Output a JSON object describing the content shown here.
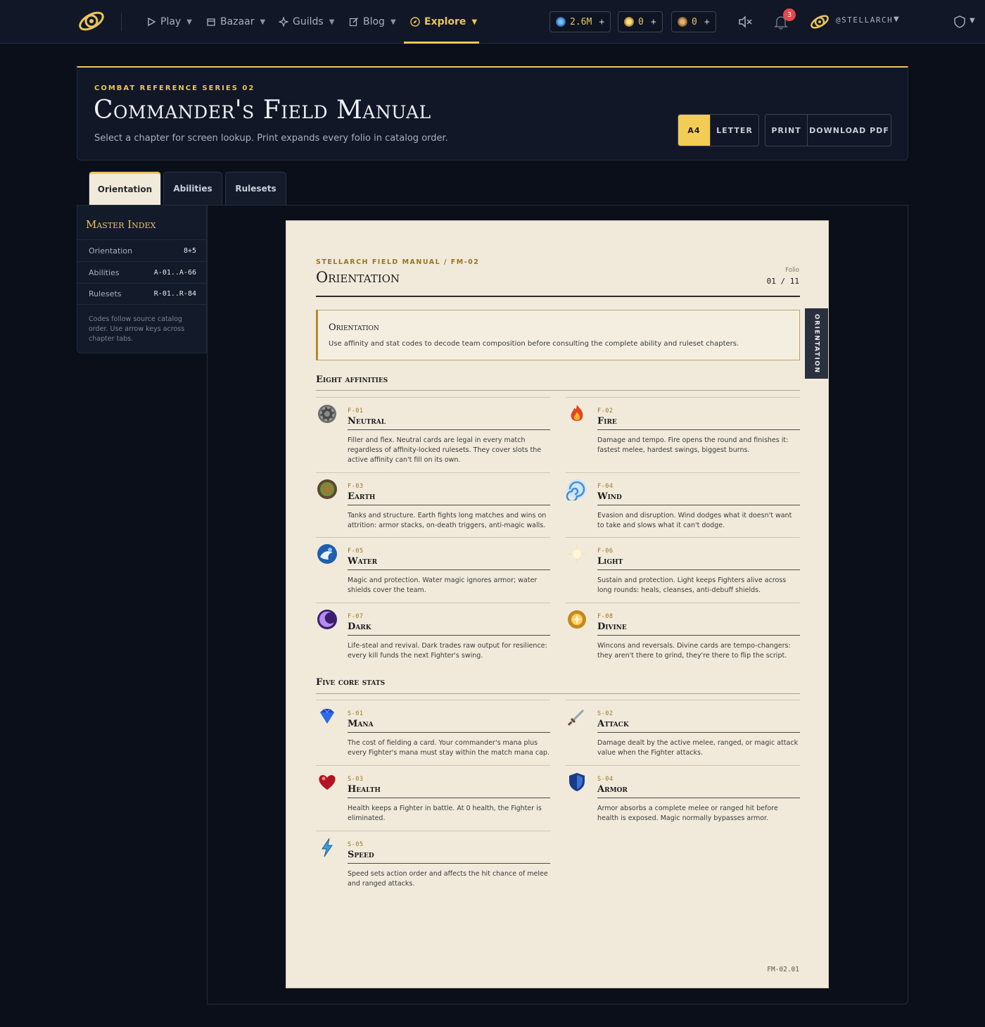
{
  "nav": {
    "items": [
      {
        "label": "Play"
      },
      {
        "label": "Bazaar"
      },
      {
        "label": "Guilds"
      },
      {
        "label": "Blog"
      },
      {
        "label": "Explore"
      }
    ],
    "balances": [
      {
        "value": "2.6M",
        "plus": "+"
      },
      {
        "value": "0",
        "plus": "+"
      },
      {
        "value": "0",
        "plus": "+"
      }
    ],
    "notifications": "3",
    "username": "@STELLARCH"
  },
  "header": {
    "eyebrow": "COMBAT REFERENCE SERIES 02",
    "title": "Commander's Field Manual",
    "subtitle": "Select a chapter for screen lookup. Print expands every folio in catalog order.",
    "paper_sizes": [
      "A4",
      "LETTER"
    ],
    "actions": [
      "PRINT",
      "DOWNLOAD PDF"
    ]
  },
  "tabs": [
    "Orientation",
    "Abilities",
    "Rulesets"
  ],
  "sidebar": {
    "title": "Master Index",
    "rows": [
      {
        "label": "Orientation",
        "code": "8+5"
      },
      {
        "label": "Abilities",
        "code": "A-01..A-66"
      },
      {
        "label": "Rulesets",
        "code": "R-01..R-84"
      }
    ],
    "note": "Codes follow source catalog order. Use arrow keys across chapter tabs."
  },
  "paper": {
    "eyebrow": "STELLARCH FIELD MANUAL / FM-02",
    "title": "Orientation",
    "folio_label": "Folio",
    "folio": "01 / 11",
    "side_tab": "ORIENTATION",
    "callout": {
      "title": "Orientation",
      "body": "Use affinity and stat codes to decode team composition before consulting the complete ability and ruleset chapters."
    },
    "affinities_title": "Eight affinities",
    "affinities": [
      {
        "code": "F-01",
        "name": "Neutral",
        "icon": "neutral-gear-icon",
        "desc": "Filler and flex. Neutral cards are legal in every match regardless of affinity-locked rulesets. They cover slots the active affinity can't fill on its own."
      },
      {
        "code": "F-02",
        "name": "Fire",
        "icon": "fire-icon",
        "desc": "Damage and tempo. Fire opens the round and finishes it: fastest melee, hardest swings, biggest burns."
      },
      {
        "code": "F-03",
        "name": "Earth",
        "icon": "earth-icon",
        "desc": "Tanks and structure. Earth fights long matches and wins on attrition: armor stacks, on-death triggers, anti-magic walls."
      },
      {
        "code": "F-04",
        "name": "Wind",
        "icon": "wind-icon",
        "desc": "Evasion and disruption. Wind dodges what it doesn't want to take and slows what it can't dodge."
      },
      {
        "code": "F-05",
        "name": "Water",
        "icon": "water-icon",
        "desc": "Magic and protection. Water magic ignores armor; water shields cover the team."
      },
      {
        "code": "F-06",
        "name": "Light",
        "icon": "light-icon",
        "desc": "Sustain and protection. Light keeps Fighters alive across long rounds: heals, cleanses, anti-debuff shields."
      },
      {
        "code": "F-07",
        "name": "Dark",
        "icon": "dark-icon",
        "desc": "Life-steal and revival. Dark trades raw output for resilience: every kill funds the next Fighter's swing."
      },
      {
        "code": "F-08",
        "name": "Divine",
        "icon": "divine-icon",
        "desc": "Wincons and reversals. Divine cards are tempo-changers: they aren't there to grind, they're there to flip the script."
      }
    ],
    "stats_title": "Five core stats",
    "stats": [
      {
        "code": "S-01",
        "name": "Mana",
        "icon": "mana-gem-icon",
        "desc": "The cost of fielding a card. Your commander's mana plus every Fighter's mana must stay within the match mana cap."
      },
      {
        "code": "S-02",
        "name": "Attack",
        "icon": "sword-icon",
        "desc": "Damage dealt by the active melee, ranged, or magic attack value when the Fighter attacks."
      },
      {
        "code": "S-03",
        "name": "Health",
        "icon": "heart-icon",
        "desc": "Health keeps a Fighter in battle. At 0 health, the Fighter is eliminated."
      },
      {
        "code": "S-04",
        "name": "Armor",
        "icon": "shield-icon",
        "desc": "Armor absorbs a complete melee or ranged hit before health is exposed. Magic normally bypasses armor."
      },
      {
        "code": "S-05",
        "name": "Speed",
        "icon": "lightning-icon",
        "desc": "Speed sets action order and affects the hit chance of melee and ranged attacks."
      }
    ],
    "footer": "FM-02.01"
  },
  "colors": {
    "accent": "#e9c55a",
    "paper": "#f1eadb",
    "background": "#0b0f19"
  }
}
